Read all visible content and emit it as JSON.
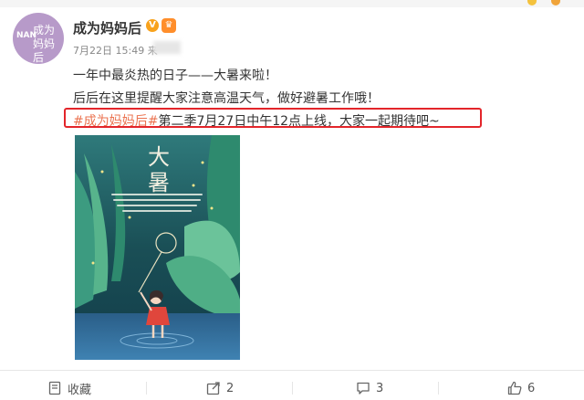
{
  "post": {
    "author": "成为妈妈后",
    "avatar_text": "成为妈妈后",
    "avatar_brand": "NAN",
    "date": "7月22日 15:49 来",
    "line1": "一年中最炎热的日子——大暑来啦！",
    "line2": "后后在这里提醒大家注意高温天气，做好避暑工作哦！",
    "topic": "#成为妈妈后#",
    "line3_rest": "第二季7月27日中午12点上线，大家一起期待吧~",
    "poster_title_1": "大",
    "poster_title_2": "暑"
  },
  "actions": {
    "favorite_label": "收藏",
    "share_count": "2",
    "comment_count": "3",
    "like_count": "6"
  },
  "colors": {
    "topic": "#eb7350",
    "highlight": "#e3252a",
    "poster_bg": "#1f5a5e"
  }
}
